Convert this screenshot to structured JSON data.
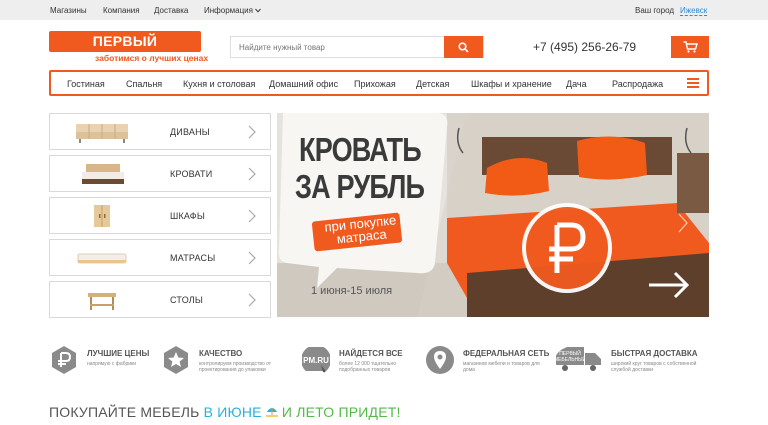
{
  "topbar": {
    "links": [
      "Магазины",
      "Компания",
      "Доставка",
      "Информация"
    ],
    "geo_label": "Ваш город",
    "city": "Ижевск"
  },
  "header": {
    "logo_text": "ПЕРВЫЙ МЕБЕЛЬНЫЙ",
    "logo_tagline": "заботимся о лучших ценах",
    "search_placeholder": "Найдите нужный товар",
    "phone": "+7 (495) 256-26-79",
    "cart_icon": "cart-icon",
    "search_icon": "search-icon"
  },
  "nav": {
    "items": [
      "Гостиная",
      "Спальня",
      "Кухня и столовая",
      "Домашний офис",
      "Прихожая",
      "Детская",
      "Шкафы и хранение",
      "Дача",
      "Распродажа"
    ],
    "menu_icon": "hamburger-icon"
  },
  "categories": [
    {
      "label": "ДИВАНЫ",
      "icon": "sofa-image"
    },
    {
      "label": "КРОВАТИ",
      "icon": "bed-image"
    },
    {
      "label": "ШКАФЫ",
      "icon": "wardrobe-image"
    },
    {
      "label": "МАТРАСЫ",
      "icon": "mattress-image"
    },
    {
      "label": "СТОЛЫ",
      "icon": "table-image"
    }
  ],
  "banner": {
    "headline_1": "КРОВАТЬ",
    "headline_2": "ЗА РУБЛЬ",
    "tag_1": "при покупке",
    "tag_2": "матраса",
    "dates": "1 июня-15 июля",
    "accent": "#f05a1f"
  },
  "features": [
    {
      "title": "ЛУЧШИЕ ЦЕНЫ",
      "sub": "напрямую с фабрики",
      "icon": "ruble-icon"
    },
    {
      "title": "КАЧЕСТВО",
      "sub": "контролируем производство от проектирования до упаковки",
      "icon": "star-icon"
    },
    {
      "title": "НАЙДЕТСЯ ВСЕ",
      "sub": "более 12 000 тщательно подобранных товаров",
      "icon": "pm-ru-icon"
    },
    {
      "title": "ФЕДЕРАЛЬНАЯ СЕТЬ",
      "sub": "магазинов мебели и товаров для дома",
      "icon": "map-pin-icon"
    },
    {
      "title": "БЫСТРАЯ ДОСТАВКА",
      "sub": "широкий круг товаров с собственной службой доставки",
      "icon": "truck-icon"
    }
  ],
  "promo": {
    "part1": "ПОКУПАЙТЕ МЕБЕЛЬ ",
    "part2": "В ИЮНЕ",
    "part3": " И ЛЕТО ПРИДЕТ!"
  }
}
